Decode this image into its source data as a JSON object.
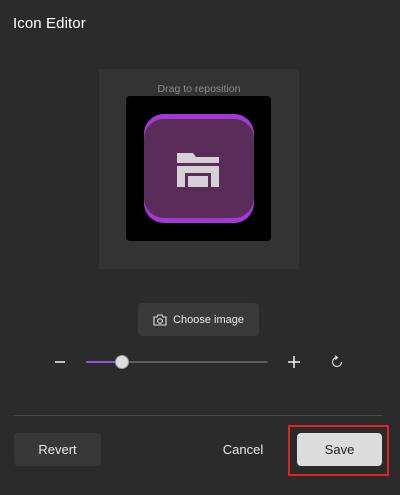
{
  "dialog": {
    "title": "Icon Editor"
  },
  "preview": {
    "hint": "Drag to reposition",
    "icon": "folder-icon",
    "icon_bg_color": "#5a2c5a",
    "icon_accent_color": "#a238d6"
  },
  "choose_image": {
    "label": "Choose image",
    "icon": "camera-icon"
  },
  "zoom": {
    "minus_icon": "minus-icon",
    "plus_icon": "plus-icon",
    "reset_icon": "rotate-reset-icon",
    "level": 0.2,
    "accent_color": "#8e56d9"
  },
  "footer": {
    "revert_label": "Revert",
    "cancel_label": "Cancel",
    "save_label": "Save",
    "highlight_color": "#e02424"
  }
}
